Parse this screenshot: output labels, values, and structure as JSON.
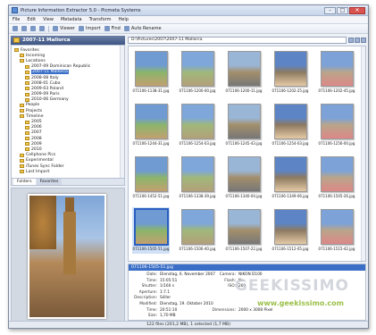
{
  "window": {
    "title": "Picture Information Extractor 5.0 - Picmeta Systems",
    "controls": [
      "–",
      "□",
      "✕"
    ]
  },
  "menu": [
    "File",
    "Edit",
    "View",
    "Metadata",
    "Transform",
    "Help"
  ],
  "toolbar": {
    "viewer": "Viewer",
    "import": "Import",
    "find": "Find",
    "auto_rename": "Auto Rename"
  },
  "left": {
    "folder_title": "2007-11 Mallorca",
    "tree": [
      {
        "label": "Favorites",
        "indent": 0
      },
      {
        "label": "Incoming",
        "indent": 1
      },
      {
        "label": "Locations",
        "indent": 1
      },
      {
        "label": "2007-09 Dominican Republic",
        "indent": 2
      },
      {
        "label": "2007-11 Mallorca",
        "indent": 2,
        "selected": true
      },
      {
        "label": "2008-08 Italy",
        "indent": 2
      },
      {
        "label": "2008-01 Cuba",
        "indent": 2
      },
      {
        "label": "2009-03 Poland",
        "indent": 2
      },
      {
        "label": "2009-09 Paris",
        "indent": 2
      },
      {
        "label": "2010-06 Germany",
        "indent": 2
      },
      {
        "label": "People",
        "indent": 1
      },
      {
        "label": "Projects",
        "indent": 1
      },
      {
        "label": "Timeline",
        "indent": 1
      },
      {
        "label": "2005",
        "indent": 2
      },
      {
        "label": "2006",
        "indent": 2
      },
      {
        "label": "2007",
        "indent": 2
      },
      {
        "label": "2008",
        "indent": 2
      },
      {
        "label": "2009",
        "indent": 2
      },
      {
        "label": "2010",
        "indent": 2
      },
      {
        "label": "Cellphone Pics",
        "indent": 1
      },
      {
        "label": "Experimental",
        "indent": 1
      },
      {
        "label": "iTunes Sync Folder",
        "indent": 1
      },
      {
        "label": "Last Import",
        "indent": 1
      }
    ],
    "tabs": [
      "Folders",
      "Favorites"
    ]
  },
  "address": "D:\\Pictures\\2007\\2007-11 Mallorca",
  "thumbnails": [
    "071106-1138-31.jpg",
    "071106-1200-00.jpg",
    "071106-1200-11.jpg",
    "071106-1202-25.jpg",
    "071106-1202-45.jpg",
    "071106-1244-31.jpg",
    "071106-1254-03.jpg",
    "071106-1245-43.jpg",
    "071106-1254-03.jpg",
    "071106-1256-00.jpg",
    "071106-1452-51.jpg",
    "071106-1338-39.jpg",
    "071106-1340-04.jpg",
    "071106-1349-06.jpg",
    "071106-1505-26.jpg",
    "071106-1505-51.jpg",
    "071106-1506-40.jpg",
    "071106-1507-22.jpg",
    "071106-1512-05.jpg",
    "071106-1515-42.jpg"
  ],
  "selected_index": 15,
  "info": {
    "header": "071106-1505-51.jpg",
    "rows": [
      {
        "k": "Date:",
        "v": "Dienstag, 6. November 2007"
      },
      {
        "k": "Time:",
        "v": "15:05:51"
      },
      {
        "k": "Shutter:",
        "v": "1/160 s"
      },
      {
        "k": "Aperture:",
        "v": "1:7.1"
      },
      {
        "k": "Description:",
        "v": "Sóller"
      },
      {
        "k": "Modified:",
        "v": "Dienstag, 19. Oktober 2010"
      },
      {
        "k": "Time:",
        "v": "20:51:10"
      },
      {
        "k": "Size:",
        "v": "1,70 MB"
      }
    ],
    "rows2": [
      {
        "k": "Camera:",
        "v": "NIKON D100"
      },
      {
        "k": "Flash:",
        "v": "No"
      },
      {
        "k": "ISO:",
        "v": "200"
      },
      {
        "k": "Dimensions:",
        "v": "2000 x 3008 Pixel"
      }
    ]
  },
  "status": "122 files (201,2 MB), 1 selected (1,7 MB)",
  "watermark": "GEEKISSIMO",
  "watermark_url": "www.geekissimo.com"
}
